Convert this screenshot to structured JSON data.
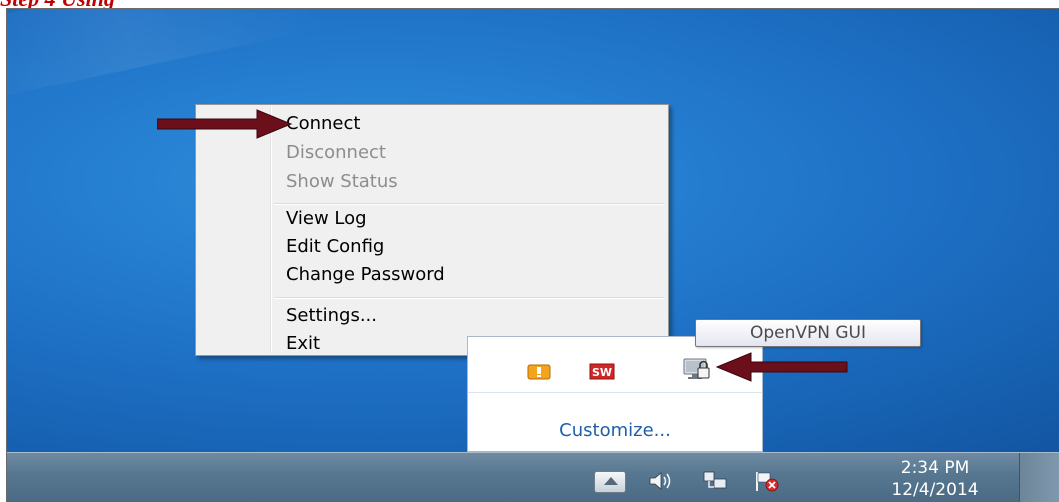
{
  "document": {
    "heading_fragment": "Step 4 Using"
  },
  "context_menu": {
    "items": [
      {
        "label": "Connect",
        "enabled": true
      },
      {
        "label": "Disconnect",
        "enabled": false
      },
      {
        "label": "Show Status",
        "enabled": false
      },
      {
        "label": "View Log",
        "enabled": true
      },
      {
        "label": "Edit Config",
        "enabled": true
      },
      {
        "label": "Change Password",
        "enabled": true
      },
      {
        "label": "Settings...",
        "enabled": true
      },
      {
        "label": "Exit",
        "enabled": true
      }
    ]
  },
  "tooltip": {
    "text": "OpenVPN GUI"
  },
  "tray_overflow": {
    "icons": [
      "alert-shield-icon",
      "sw-app-icon",
      "openvpn-monitor-icon"
    ],
    "customize_label": "Customize..."
  },
  "taskbar": {
    "system_icons": [
      "show-hidden-icons-button",
      "volume-icon",
      "network-icon",
      "action-center-flag-icon"
    ],
    "time": "2:34 PM",
    "date": "12/4/2014"
  },
  "colors": {
    "annotation_arrow": "#6b0f1a",
    "heading": "#c00000",
    "desktop": "#1d6fc4",
    "link": "#1f5fa8",
    "taskbar": "#587891"
  }
}
